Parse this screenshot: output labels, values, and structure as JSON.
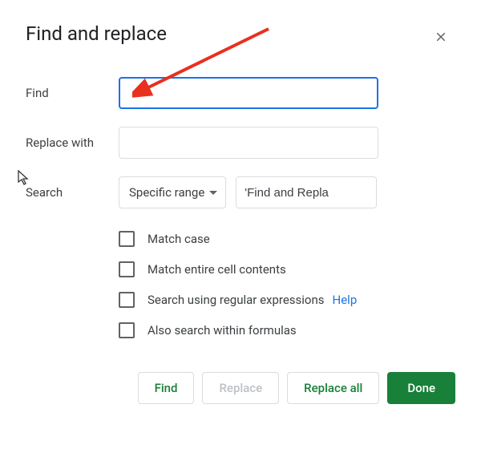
{
  "dialog": {
    "title": "Find and replace"
  },
  "labels": {
    "find": "Find",
    "replaceWith": "Replace with",
    "search": "Search"
  },
  "inputs": {
    "findValue": "",
    "replaceValue": "",
    "rangeValue": "'Find and Repla"
  },
  "dropdown": {
    "searchScope": "Specific range"
  },
  "options": {
    "matchCase": "Match case",
    "matchEntireCell": "Match entire cell contents",
    "regex": "Search using regular expressions",
    "helpLink": "Help",
    "withinFormulas": "Also search within formulas"
  },
  "buttons": {
    "find": "Find",
    "replace": "Replace",
    "replaceAll": "Replace all",
    "done": "Done"
  }
}
